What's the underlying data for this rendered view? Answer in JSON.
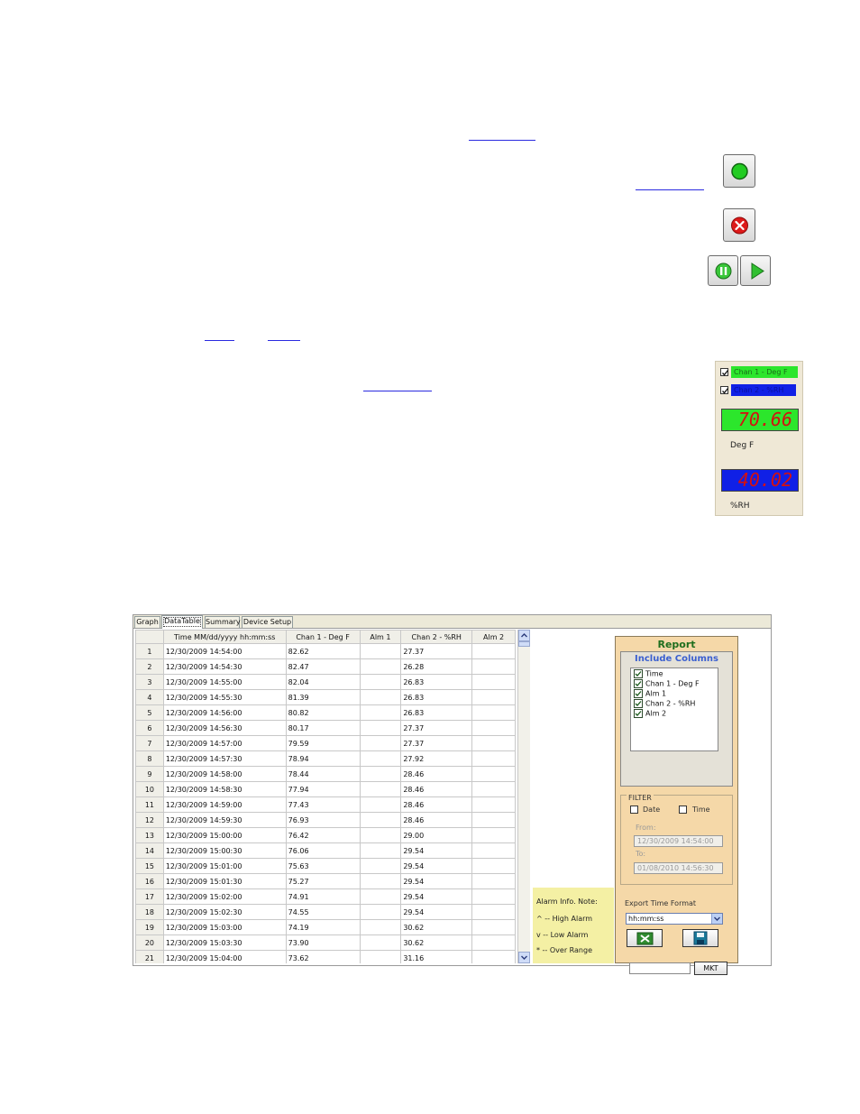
{
  "top_buttons": {
    "start_icon": "green-circle-icon",
    "stop_icon": "red-x-icon",
    "pause_icon": "pause-icon",
    "resume_icon": "play-icon"
  },
  "channel_panel": {
    "chan1_label": "Chan 1 - Deg F",
    "chan1_color": "#2ce62c",
    "chan2_label": "Chan 2 - %RH",
    "chan2_color": "#1020e6",
    "chan1_reading": "70.66",
    "chan1_unit": "Deg F",
    "chan2_reading": "40.02",
    "chan2_unit": "%RH"
  },
  "tabs": [
    {
      "label": "Graph"
    },
    {
      "label": "DataTable"
    },
    {
      "label": "Summary"
    },
    {
      "label": "Device Setup"
    }
  ],
  "table": {
    "headers": [
      "Time   MM/dd/yyyy hh:mm:ss",
      "Chan 1 - Deg F",
      "Alm 1",
      "Chan 2 - %RH",
      "Alm 2"
    ],
    "rows": [
      [
        "1",
        "12/30/2009 14:54:00",
        "82.62",
        "",
        "27.37",
        ""
      ],
      [
        "2",
        "12/30/2009 14:54:30",
        "82.47",
        "",
        "26.28",
        ""
      ],
      [
        "3",
        "12/30/2009 14:55:00",
        "82.04",
        "",
        "26.83",
        ""
      ],
      [
        "4",
        "12/30/2009 14:55:30",
        "81.39",
        "",
        "26.83",
        ""
      ],
      [
        "5",
        "12/30/2009 14:56:00",
        "80.82",
        "",
        "26.83",
        ""
      ],
      [
        "6",
        "12/30/2009 14:56:30",
        "80.17",
        "",
        "27.37",
        ""
      ],
      [
        "7",
        "12/30/2009 14:57:00",
        "79.59",
        "",
        "27.37",
        ""
      ],
      [
        "8",
        "12/30/2009 14:57:30",
        "78.94",
        "",
        "27.92",
        ""
      ],
      [
        "9",
        "12/30/2009 14:58:00",
        "78.44",
        "",
        "28.46",
        ""
      ],
      [
        "10",
        "12/30/2009 14:58:30",
        "77.94",
        "",
        "28.46",
        ""
      ],
      [
        "11",
        "12/30/2009 14:59:00",
        "77.43",
        "",
        "28.46",
        ""
      ],
      [
        "12",
        "12/30/2009 14:59:30",
        "76.93",
        "",
        "28.46",
        ""
      ],
      [
        "13",
        "12/30/2009 15:00:00",
        "76.42",
        "",
        "29.00",
        ""
      ],
      [
        "14",
        "12/30/2009 15:00:30",
        "76.06",
        "",
        "29.54",
        ""
      ],
      [
        "15",
        "12/30/2009 15:01:00",
        "75.63",
        "",
        "29.54",
        ""
      ],
      [
        "16",
        "12/30/2009 15:01:30",
        "75.27",
        "",
        "29.54",
        ""
      ],
      [
        "17",
        "12/30/2009 15:02:00",
        "74.91",
        "",
        "29.54",
        ""
      ],
      [
        "18",
        "12/30/2009 15:02:30",
        "74.55",
        "",
        "29.54",
        ""
      ],
      [
        "19",
        "12/30/2009 15:03:00",
        "74.19",
        "",
        "30.62",
        ""
      ],
      [
        "20",
        "12/30/2009 15:03:30",
        "73.90",
        "",
        "30.62",
        ""
      ],
      [
        "21",
        "12/30/2009 15:04:00",
        "73.62",
        "",
        "31.16",
        ""
      ]
    ]
  },
  "alarm_note": {
    "title": "Alarm Info. Note:",
    "high": "^ -- High Alarm",
    "low": "v -- Low Alarm",
    "over": "* -- Over Range"
  },
  "report": {
    "title": "Report",
    "include_title": "Include Columns",
    "columns": [
      "Time",
      "Chan 1 - Deg F",
      "Alm 1",
      "Chan 2 - %RH",
      "Alm 2"
    ],
    "filter_label": "FILTER",
    "date_label": "Date",
    "time_label": "Time",
    "from_label": "From:",
    "from_value": "12/30/2009 14:54:00",
    "to_label": "To:",
    "to_value": "01/08/2010 14:56:30",
    "export_label": "Export Time Format",
    "export_value": "hh:mm:ss",
    "excel_icon": "excel-icon",
    "save_icon": "floppy-disk-icon",
    "mkt_label": "MKT"
  }
}
